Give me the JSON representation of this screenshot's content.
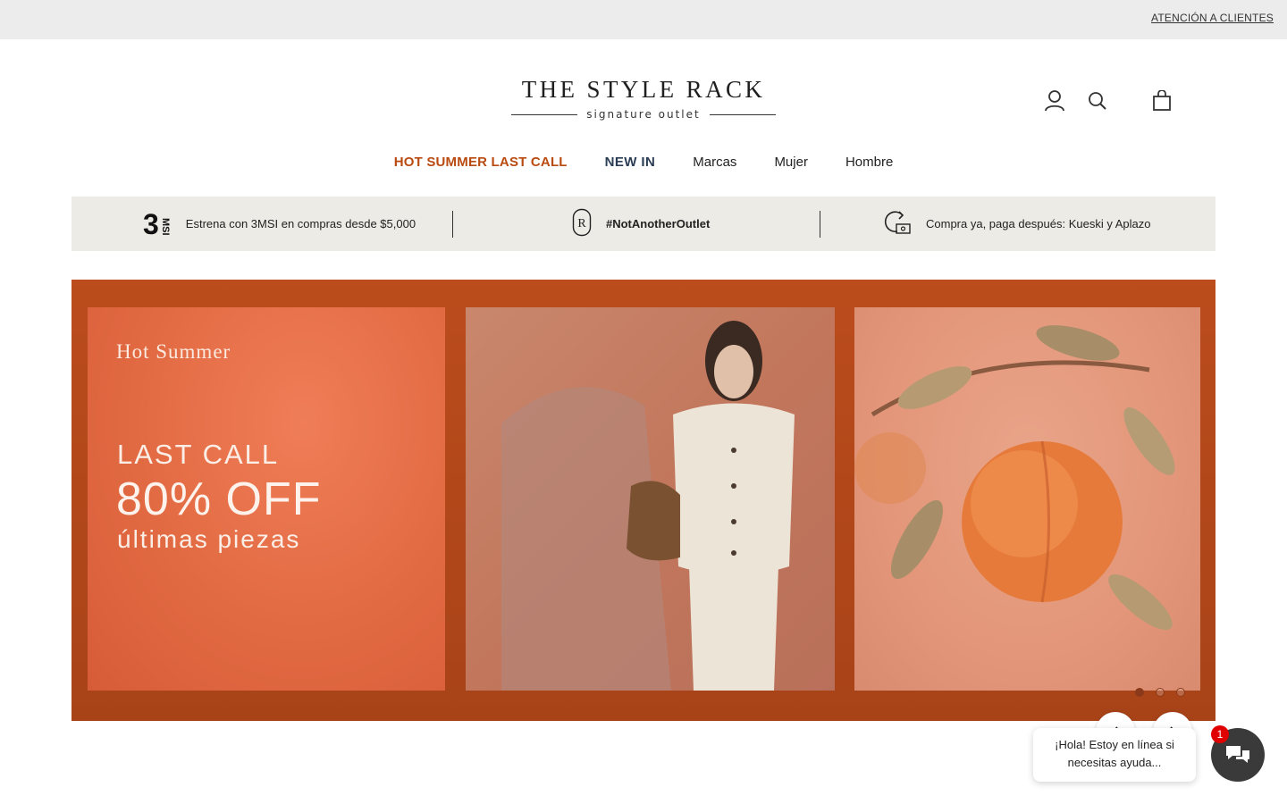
{
  "topbar": {
    "customer_service": "ATENCIÓN A CLIENTES"
  },
  "logo": {
    "name": "THE STYLE RACK",
    "tagline": "signature outlet"
  },
  "header": {
    "icons": [
      "account-icon",
      "search-icon",
      "cart-icon"
    ]
  },
  "nav": {
    "items": [
      {
        "label": "HOT SUMMER LAST CALL",
        "color": "#b94a10"
      },
      {
        "label": "NEW IN",
        "color": "#2a3d55"
      },
      {
        "label": "Marcas"
      },
      {
        "label": "Mujer"
      },
      {
        "label": "Hombre"
      }
    ]
  },
  "benefits": [
    {
      "icon": "3msi-icon",
      "icon_text": "3",
      "icon_sub": "MSI",
      "text": "Estrena con 3MSI en compras desde $5,000"
    },
    {
      "icon": "tsr-monogram-icon",
      "text": "#NotAnotherOutlet"
    },
    {
      "icon": "pay-later-icon",
      "text": "Compra ya, paga después: Kueski y Aplazo"
    }
  ],
  "hero": {
    "kicker": "Hot Summer",
    "line1": "LAST CALL",
    "line2": "80% OFF",
    "line3": "últimas piezas",
    "slides_total": 3,
    "active_slide": 1
  },
  "chat": {
    "message": "¡Hola! Estoy en línea si necesitas ayuda...",
    "badge": "1"
  },
  "colors": {
    "hot": "#b94a10",
    "hero_bg": "#b94a18",
    "benefit_bg": "#ecebe5"
  }
}
